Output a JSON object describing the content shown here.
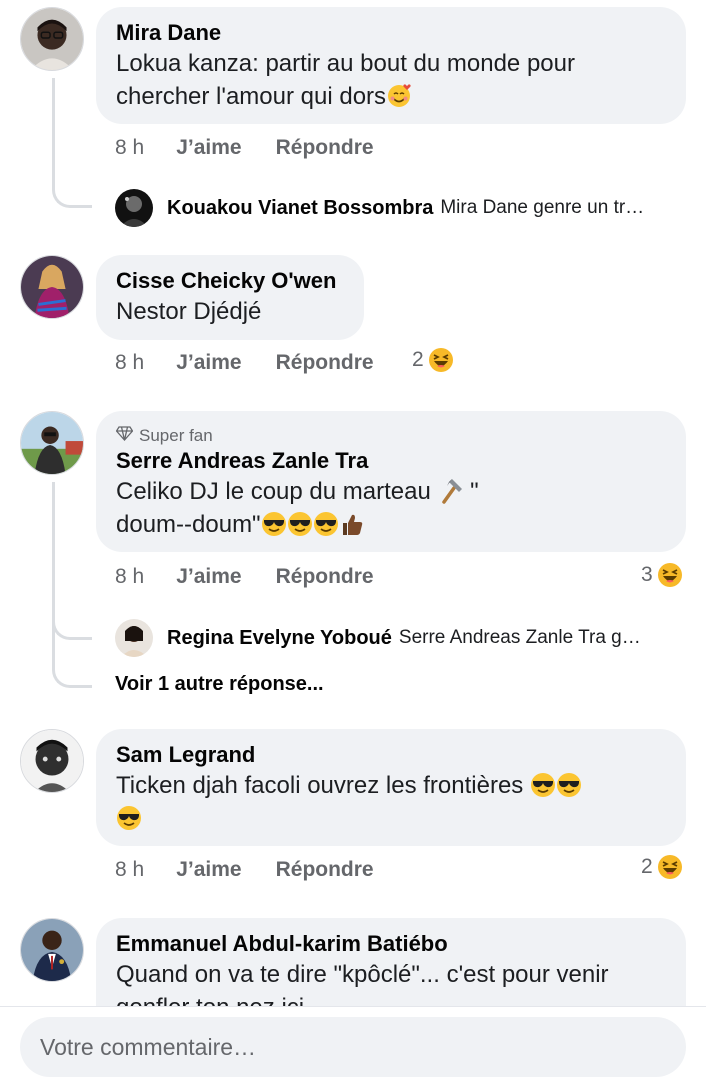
{
  "comments": [
    {
      "author": "Mira Dane",
      "line1": "Lokua kanza: partir au bout du monde pour",
      "line2": "chercher l'amour qui dors",
      "time": "8 h",
      "like": "J’aime",
      "reply": "Répondre",
      "replies": [
        {
          "author": "Kouakou Vianet Bossombra",
          "text": "Mira Dane genre un tr…"
        }
      ]
    },
    {
      "author": "Cisse Cheicky O'wen",
      "line1": "Nestor Djédjé",
      "time": "8 h",
      "like": "J’aime",
      "reply": "Répondre",
      "reaction_count": "2"
    },
    {
      "badge": "Super fan",
      "author": "Serre Andreas Zanle Tra",
      "line1": "Celiko DJ  le coup du  marteau",
      "line1_after": " \"",
      "line2": "doum--doum\"",
      "time": "8 h",
      "like": "J’aime",
      "reply": "Répondre",
      "reaction_count": "3",
      "replies": [
        {
          "author": "Regina Evelyne Yoboué",
          "text": "Serre Andreas Zanle Tra g…"
        }
      ],
      "more_replies": "Voir 1 autre réponse..."
    },
    {
      "author": "Sam Legrand",
      "line1": "Ticken djah facoli ouvrez les frontières",
      "time": "8 h",
      "like": "J’aime",
      "reply": "Répondre",
      "reaction_count": "2"
    },
    {
      "author": "Emmanuel Abdul-karim Batiébo",
      "line1": "Quand on va te dire \"kpôclé\"... c'est pour venir",
      "line2": "gonfler ton nez ici"
    }
  ],
  "composer": {
    "placeholder": "Votre commentaire…"
  },
  "icons": {
    "reaction": "haha-reaction-icon",
    "badge": "diamond-icon",
    "emojis": [
      "smiling-face-with-hearts",
      "hammer",
      "smiling-face-with-sunglasses",
      "thumbs-up"
    ]
  },
  "colors": {
    "bubble": "#f0f2f5",
    "meta": "#65676b",
    "haha": "#f7b928"
  }
}
